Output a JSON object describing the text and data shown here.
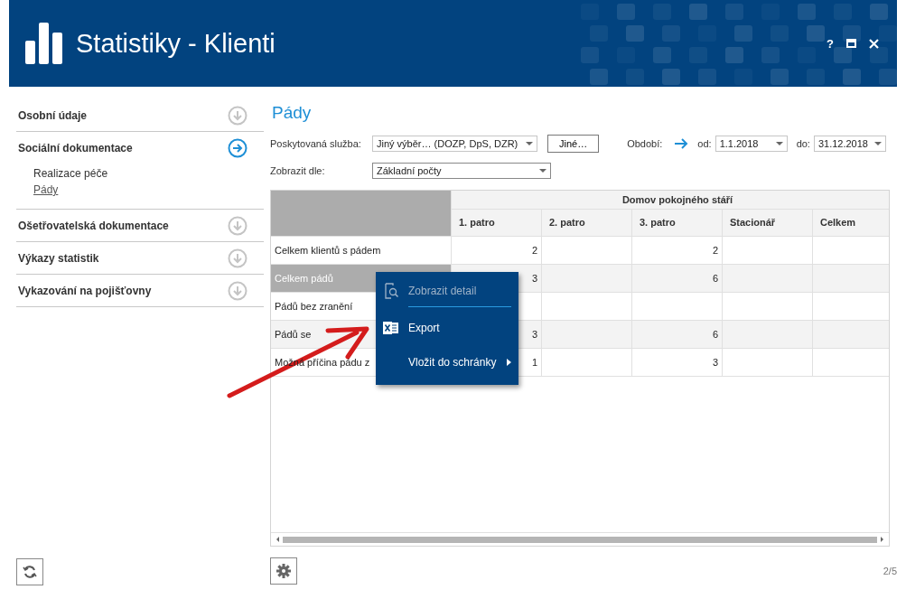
{
  "window": {
    "title": "Statistiky - Klienti",
    "help": "?"
  },
  "sidebar": {
    "sections": [
      {
        "label": "Osobní údaje",
        "expanded": false
      },
      {
        "label": "Sociální dokumentace",
        "expanded": true,
        "children": [
          {
            "label": "Realizace péče",
            "selected": false
          },
          {
            "label": "Pády",
            "selected": true
          }
        ]
      },
      {
        "label": "Ošetřovatelská dokumentace",
        "expanded": false
      },
      {
        "label": "Výkazy statistik",
        "expanded": false
      },
      {
        "label": "Vykazování na pojišťovny",
        "expanded": false
      }
    ]
  },
  "page": {
    "title": "Pády"
  },
  "filters": {
    "service": {
      "label": "Poskytovaná služba:",
      "value": "Jiný výběr… (DOZP, DpS, DZR)"
    },
    "other_button": "Jiné…",
    "period_label": "Období:",
    "from": {
      "label": "od:",
      "value": "1.1.2018"
    },
    "to": {
      "label": "do:",
      "value": "31.12.2018"
    },
    "view": {
      "label": "Zobrazit dle:",
      "value": "Základní počty"
    }
  },
  "table": {
    "group": "Domov pokojného stáří",
    "columns": [
      "1. patro",
      "2. patro",
      "3. patro",
      "Stacionář",
      "Celkem"
    ],
    "rows": [
      {
        "label": "Celkem klientů s pádem",
        "selected": false,
        "cells": [
          "2",
          null,
          "2",
          null,
          null
        ]
      },
      {
        "label": "Celkem pádů",
        "selected": true,
        "cells": [
          "3",
          null,
          "6",
          null,
          null
        ]
      },
      {
        "label": "Pádů bez zranění",
        "selected": false,
        "cells": [
          null,
          null,
          null,
          null,
          null
        ]
      },
      {
        "label": "Pádů se",
        "selected": false,
        "cells": [
          "3",
          null,
          "6",
          null,
          null
        ]
      },
      {
        "label": "Možná příčina pádu z",
        "selected": false,
        "cells": [
          "1",
          null,
          "3",
          null,
          null
        ]
      }
    ]
  },
  "context_menu": {
    "items": [
      {
        "label": "Zobrazit detail",
        "disabled": true,
        "separator_after": true
      },
      {
        "label": "Export",
        "disabled": false
      },
      {
        "label": "Vložit do schránky",
        "disabled": false,
        "kind": "submenu"
      }
    ]
  },
  "pager": "2/5"
}
